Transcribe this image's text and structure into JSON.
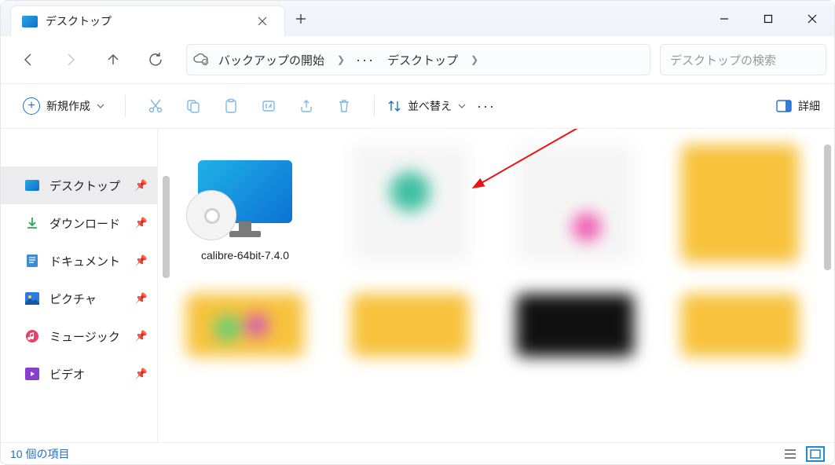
{
  "titlebar": {
    "tab_title": "デスクトップ"
  },
  "breadcrumb": {
    "backup_label": "バックアップの開始",
    "current": "デスクトップ"
  },
  "search": {
    "placeholder": "デスクトップの検索"
  },
  "toolbar": {
    "new_label": "新規作成",
    "sort_label": "並べ替え",
    "details_label": "詳細"
  },
  "sidebar": {
    "items": [
      {
        "label": "デスクトップ"
      },
      {
        "label": "ダウンロード"
      },
      {
        "label": "ドキュメント"
      },
      {
        "label": "ピクチャ"
      },
      {
        "label": "ミュージック"
      },
      {
        "label": "ビデオ"
      }
    ]
  },
  "files": {
    "calibre": {
      "name": "calibre-64bit-7.4.0"
    }
  },
  "status": {
    "count_text": "10 個の項目"
  }
}
